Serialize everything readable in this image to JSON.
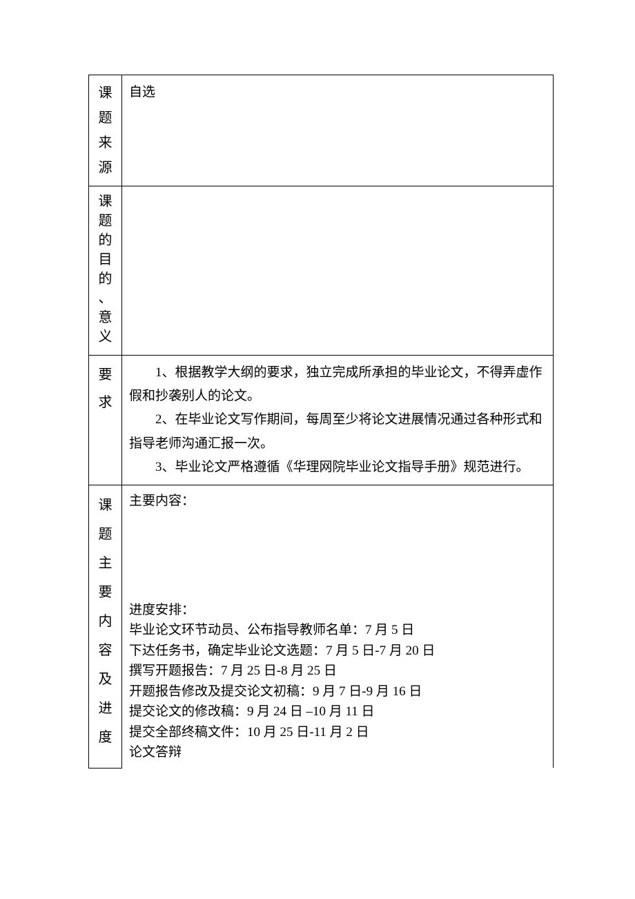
{
  "row1": {
    "label_chars": [
      "课",
      "题",
      "来",
      "源"
    ],
    "content": "自选"
  },
  "row2": {
    "label_chars": [
      "课",
      "题",
      "的",
      "目",
      "的",
      "、",
      "意",
      "义"
    ],
    "content": ""
  },
  "row3": {
    "label_chars": [
      "要",
      "求"
    ],
    "items": [
      "1、根据教学大纲的要求，独立完成所承担的毕业论文，不得弄虚作假和抄袭别人的论文。",
      "2、在毕业论文写作期间，每周至少将论文进展情况通过各种形式和指导老师沟通汇报一次。",
      "3、毕业论文严格遵循《华理网院毕业论文指导手册》规范进行。"
    ]
  },
  "row4": {
    "label_chars": [
      "课",
      "题",
      "主",
      "要",
      "内",
      "容",
      "及",
      "进",
      "度"
    ],
    "main_heading": "主要内容：",
    "schedule_heading": "进度安排：",
    "schedule_items": [
      "毕业论文环节动员、公布指导教师名单：7 月 5 日",
      "下达任务书，确定毕业论文选题：7 月 5 日-7 月 20 日",
      "撰写开题报告：7 月 25 日-8 月 25 日",
      "开题报告修改及提交论文初稿：9 月 7 日-9 月 16 日",
      "提交论文的修改稿：9 月 24 日 –10 月 11 日",
      "提交全部终稿文件：10 月 25 日-11 月 2 日",
      "论文答辩"
    ]
  }
}
